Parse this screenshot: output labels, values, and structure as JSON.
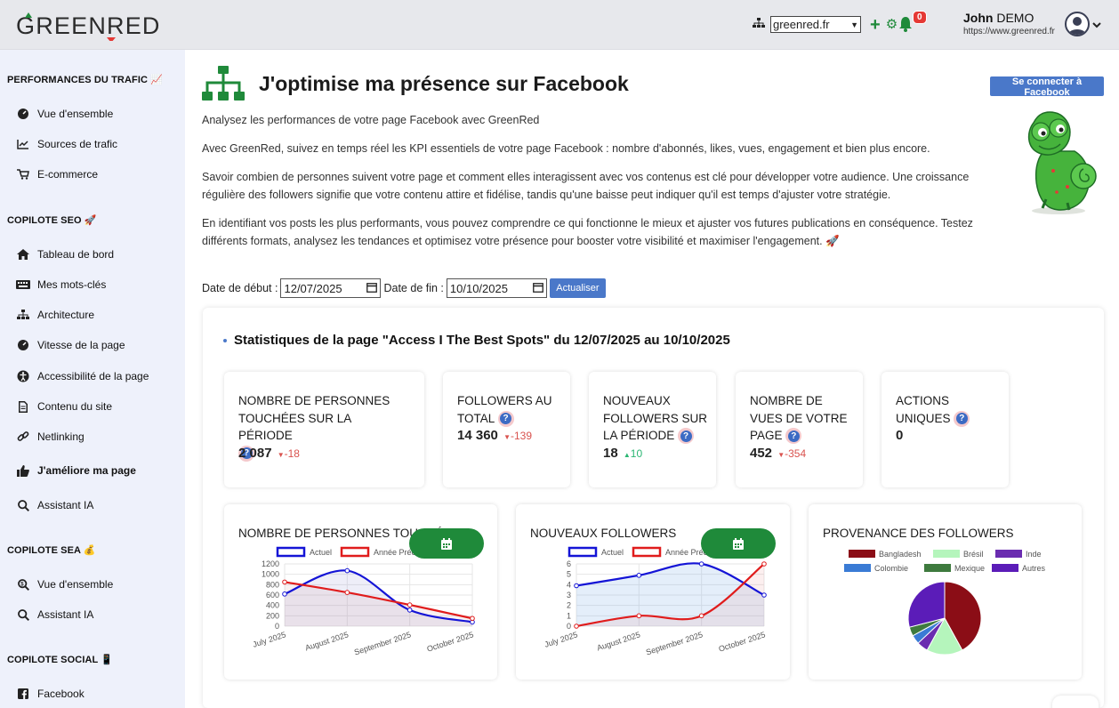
{
  "header": {
    "logo_text": "GREENRED",
    "site_selected": "greenred.fr",
    "notification_count": "0",
    "user_first": "John",
    "user_last": "DEMO",
    "user_url": "https://www.greenred.fr"
  },
  "sidebar": {
    "sections": [
      {
        "title": "PERFORMANCES DU TRAFIC 📈",
        "items": [
          "Vue d'ensemble",
          "Sources de trafic",
          "E-commerce"
        ]
      },
      {
        "title": "COPILOTE SEO 🚀",
        "items": [
          "Tableau de bord",
          "Mes mots-clés",
          "Architecture",
          "Vitesse de la page",
          "Accessibilité de la page",
          "Contenu du site",
          "Netlinking",
          "J'améliore ma page",
          "Assistant IA"
        ]
      },
      {
        "title": "COPILOTE SEA 💰",
        "items": [
          "Vue d'ensemble",
          "Assistant IA"
        ]
      },
      {
        "title": "COPILOTE SOCIAL 📱",
        "items": [
          "Facebook"
        ]
      }
    ]
  },
  "main": {
    "title": "J'optimise ma présence sur Facebook",
    "connect_button": "Se connecter à Facebook",
    "intro": [
      "Analysez les performances de votre page Facebook avec GreenRed",
      "Avec GreenRed, suivez en temps réel les KPI essentiels de votre page Facebook : nombre d'abonnés, likes, vues, engagement et bien plus encore.",
      "Savoir combien de personnes suivent votre page et comment elles interagissent avec vos contenus est clé pour développer votre audience. Une croissance régulière des followers signifie que votre contenu attire et fidélise, tandis qu'une baisse peut indiquer qu'il est temps d'ajuster votre stratégie.",
      "En identifiant vos posts les plus performants, vous pouvez comprendre ce qui fonctionne le mieux et ajuster vos futures publications en conséquence. Testez différents formats, analysez les tendances et optimisez votre présence pour booster votre visibilité et maximiser l'engagement. 🚀"
    ],
    "date_start_label": "Date de début :",
    "date_start": "12/07/2025",
    "date_end_label": "Date de fin :",
    "date_end": "10/10/2025",
    "refresh_button": "Actualiser",
    "stats_title": "Statistiques de la page \"Access I The Best Spots\" du 12/07/2025 au 10/10/2025",
    "kpis": [
      {
        "label": "NOMBRE DE PERSONNES TOUCHÉES SUR LA PÉRIODE",
        "value": "2 087",
        "delta": "-18",
        "trend": "down"
      },
      {
        "label": "FOLLOWERS AU TOTAL",
        "value": "14 360",
        "delta": "-139",
        "trend": "down"
      },
      {
        "label": "NOUVEAUX FOLLOWERS SUR LA PÉRIODE",
        "value": "18",
        "delta": "10",
        "trend": "up"
      },
      {
        "label": "NOMBRE DE VUES DE VOTRE PAGE",
        "value": "452",
        "delta": "-354",
        "trend": "down"
      },
      {
        "label": "ACTIONS UNIQUES",
        "value": "0",
        "delta": "",
        "trend": ""
      }
    ],
    "colors": {
      "accent": "#4a78c9",
      "green": "#1f8a3a",
      "red": "#e53935"
    }
  },
  "chart_data": [
    {
      "type": "line",
      "title": "NOMBRE DE PERSONNES TOUCHÉES",
      "categories": [
        "July 2025",
        "August 2025",
        "September 2025",
        "October 2025"
      ],
      "ylim": [
        0,
        1200
      ],
      "yticks": [
        "0",
        "200",
        "400",
        "600",
        "800",
        "1000",
        "1200"
      ],
      "series": [
        {
          "name": "Actuel",
          "color": "#1414d6",
          "values": [
            620,
            1070,
            310,
            80
          ]
        },
        {
          "name": "Année Précédente",
          "color": "#e01c1c",
          "values": [
            850,
            650,
            410,
            150
          ]
        }
      ]
    },
    {
      "type": "line",
      "title": "NOUVEAUX FOLLOWERS",
      "categories": [
        "July 2025",
        "August 2025",
        "September 2025",
        "October 2025"
      ],
      "ylim": [
        0,
        6
      ],
      "yticks": [
        "0",
        "1",
        "2",
        "3",
        "4",
        "5",
        "6"
      ],
      "series": [
        {
          "name": "Actuel",
          "color": "#1414d6",
          "values": [
            3.9,
            4.9,
            6,
            3
          ]
        },
        {
          "name": "Année Précédente",
          "color": "#e01c1c",
          "values": [
            0,
            1,
            1,
            6
          ]
        }
      ]
    },
    {
      "type": "pie",
      "title": "PROVENANCE DES FOLLOWERS",
      "legend": [
        {
          "name": "Bangladesh",
          "color": "#8b0d16"
        },
        {
          "name": "Brésil",
          "color": "#b5f5bc"
        },
        {
          "name": "Inde",
          "color": "#6a2cb0"
        },
        {
          "name": "Colombie",
          "color": "#3a7bd5"
        },
        {
          "name": "Mexique",
          "color": "#3e7a3e"
        },
        {
          "name": "Autres",
          "color": "#5b1cb8"
        }
      ],
      "values": [
        42,
        16,
        5,
        4,
        4,
        29
      ]
    }
  ]
}
